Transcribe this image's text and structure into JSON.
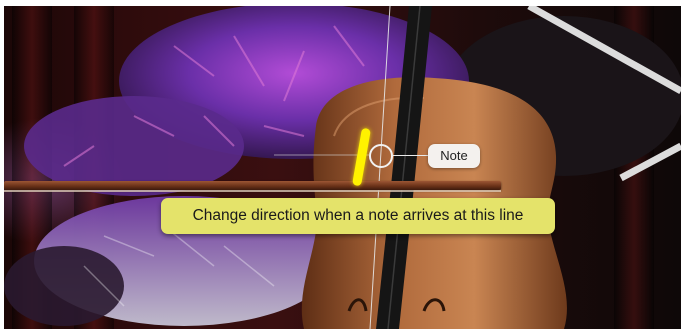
{
  "scene": {
    "colors": {
      "curtain": "#3a0f10",
      "feather": "#6a2fa8",
      "cello_wood": "#9a5a32",
      "timing_line": "#fff200",
      "tooltip_bg": "#e4e36a"
    }
  },
  "hints": {
    "note_label": "Note",
    "direction_tip": "Change direction when a note arrives at this line"
  }
}
